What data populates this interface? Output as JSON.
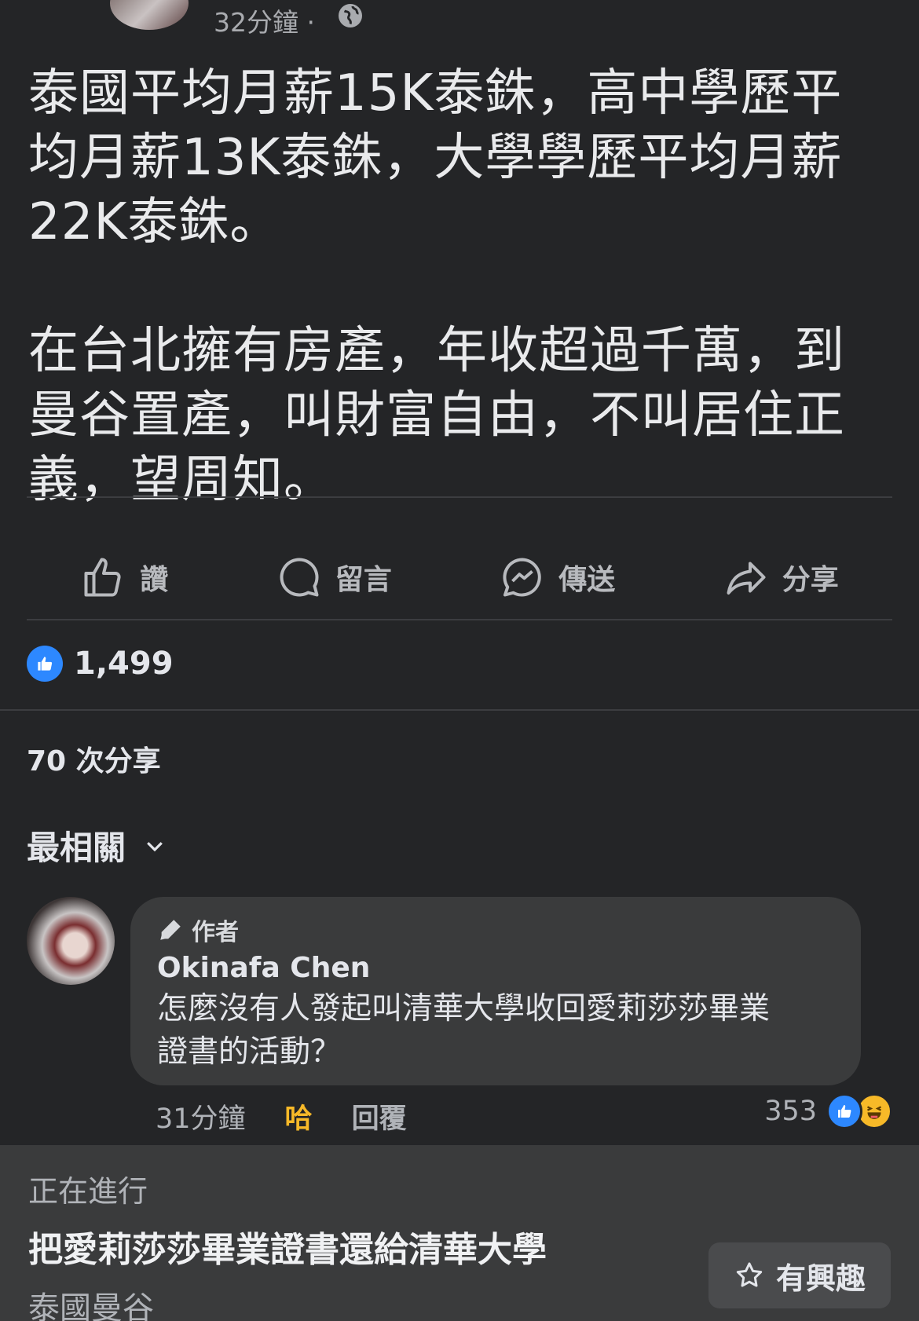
{
  "post": {
    "timestamp": "32分鐘",
    "separator": "·",
    "privacy_icon": "globe-icon",
    "text": "泰國平均月薪15K泰銖，高中學歷平\n均月薪13K泰銖，大學學歷平均月薪\n22K泰銖。\n\n在台北擁有房產，年收超過千萬，到\n曼谷置產，叫財富自由，不叫居住正\n義，望周知。"
  },
  "actions": {
    "like": "讚",
    "comment": "留言",
    "send": "傳送",
    "share": "分享"
  },
  "reactions": {
    "count": "1,499"
  },
  "shares": "70 次分享",
  "sort": {
    "label": "最相關"
  },
  "comment": {
    "author_tag": "作者",
    "name": "Okinafa Chen",
    "body": "怎麼沒有人發起叫清華大學收回愛莉莎莎畢業\n證書的活動？",
    "time": "31分鐘",
    "reacted_label": "哈",
    "reply_label": "回覆",
    "reaction_count": "353"
  },
  "banner": {
    "status": "正在進行",
    "title": "把愛莉莎莎畢業證書還給清華大學",
    "location": "泰國曼谷",
    "interest_label": "有興趣"
  },
  "colors": {
    "background": "#242527",
    "like_blue": "#2d88ff",
    "haha_yellow": "#f7b928"
  }
}
